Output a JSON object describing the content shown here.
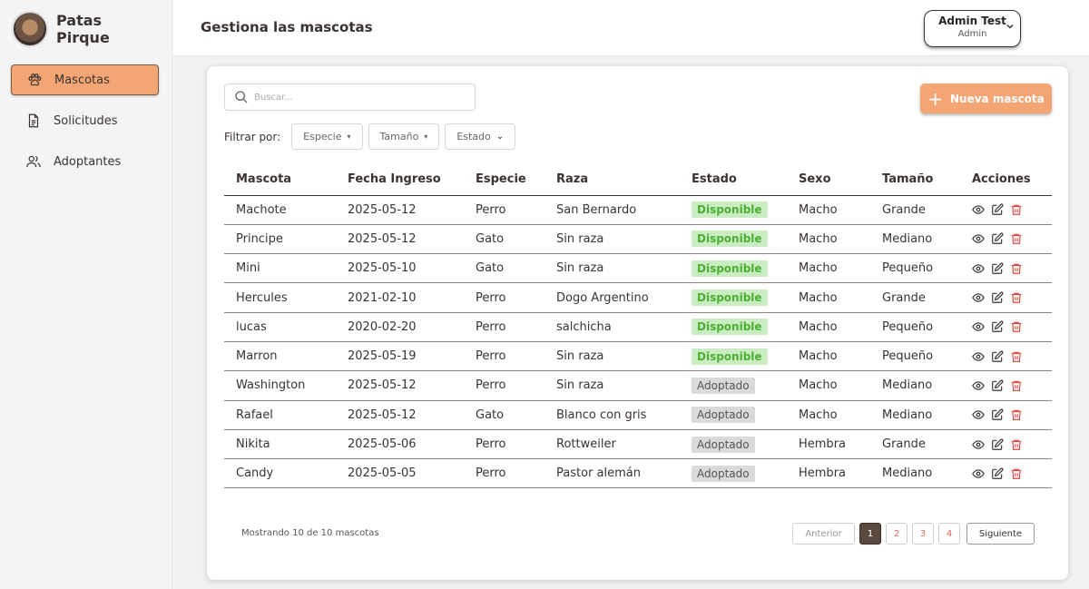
{
  "brand": {
    "name": "Patas Pirque"
  },
  "sidebar": {
    "items": [
      {
        "label": "Mascotas",
        "icon": "paw-icon",
        "active": true
      },
      {
        "label": "Solicitudes",
        "icon": "document-icon",
        "active": false
      },
      {
        "label": "Adoptantes",
        "icon": "users-icon",
        "active": false
      }
    ]
  },
  "header": {
    "title": "Gestiona las mascotas",
    "user": {
      "name": "Admin Test",
      "role": "Admin"
    }
  },
  "toolbar": {
    "search_placeholder": "Buscar...",
    "new_button": "Nueva mascota",
    "filter_label": "Filtrar por:",
    "filters": [
      "Especie",
      "Tamaño",
      "Estado"
    ]
  },
  "colors": {
    "accent": "#f4a574",
    "available_bg": "#c9ecc2",
    "available_text": "#4caf32",
    "adopted_bg": "#dadada",
    "delete_icon": "#e0443a"
  },
  "table": {
    "headers": [
      "Mascota",
      "Fecha Ingreso",
      "Especie",
      "Raza",
      "Estado",
      "Sexo",
      "Tamaño",
      "Acciones"
    ],
    "rows": [
      {
        "mascota": "Machote",
        "fecha": "2025-05-12",
        "especie": "Perro",
        "raza": "San Bernardo",
        "estado": "Disponible",
        "sexo": "Macho",
        "tamano": "Grande"
      },
      {
        "mascota": "Principe",
        "fecha": "2025-05-12",
        "especie": "Gato",
        "raza": "Sin raza",
        "estado": "Disponible",
        "sexo": "Macho",
        "tamano": "Mediano"
      },
      {
        "mascota": "Mini",
        "fecha": "2025-05-10",
        "especie": "Gato",
        "raza": "Sin raza",
        "estado": "Disponible",
        "sexo": "Macho",
        "tamano": "Pequeño"
      },
      {
        "mascota": "Hercules",
        "fecha": "2021-02-10",
        "especie": "Perro",
        "raza": "Dogo Argentino",
        "estado": "Disponible",
        "sexo": "Macho",
        "tamano": "Grande"
      },
      {
        "mascota": "lucas",
        "fecha": "2020-02-20",
        "especie": "Perro",
        "raza": "salchicha",
        "estado": "Disponible",
        "sexo": "Macho",
        "tamano": "Pequeño"
      },
      {
        "mascota": "Marron",
        "fecha": "2025-05-19",
        "especie": "Perro",
        "raza": "Sin raza",
        "estado": "Disponible",
        "sexo": "Macho",
        "tamano": "Pequeño"
      },
      {
        "mascota": "Washington",
        "fecha": "2025-05-12",
        "especie": "Perro",
        "raza": "Sin raza",
        "estado": "Adoptado",
        "sexo": "Macho",
        "tamano": "Mediano"
      },
      {
        "mascota": "Rafael",
        "fecha": "2025-05-12",
        "especie": "Gato",
        "raza": "Blanco con gris",
        "estado": "Adoptado",
        "sexo": "Macho",
        "tamano": "Mediano"
      },
      {
        "mascota": "Nikita",
        "fecha": "2025-05-06",
        "especie": "Perro",
        "raza": "Rottweiler",
        "estado": "Adoptado",
        "sexo": "Hembra",
        "tamano": "Grande"
      },
      {
        "mascota": "Candy",
        "fecha": "2025-05-05",
        "especie": "Perro",
        "raza": "Pastor alemán",
        "estado": "Adoptado",
        "sexo": "Hembra",
        "tamano": "Mediano"
      }
    ]
  },
  "footer": {
    "summary": "Mostrando 10 de 10 mascotas",
    "prev": "Anterior",
    "next": "Siguiente",
    "pages": [
      "1",
      "2",
      "3",
      "4"
    ],
    "current_page": 1
  }
}
